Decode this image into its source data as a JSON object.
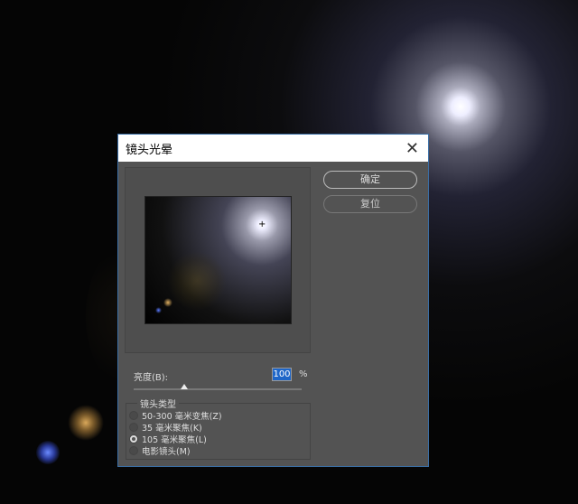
{
  "dialog": {
    "title": "镜头光晕",
    "close_icon": "close-icon"
  },
  "buttons": {
    "ok": "确定",
    "reset": "复位"
  },
  "brightness": {
    "label": "亮度(B):",
    "value": "100",
    "unit": "%",
    "slider_percent": 30
  },
  "lens_type": {
    "legend": "镜头类型",
    "options": [
      {
        "label": "50-300 毫米变焦(Z)",
        "selected": false
      },
      {
        "label": "35 毫米聚焦(K)",
        "selected": false
      },
      {
        "label": "105 毫米聚焦(L)",
        "selected": true
      },
      {
        "label": "电影镜头(M)",
        "selected": false
      }
    ]
  }
}
